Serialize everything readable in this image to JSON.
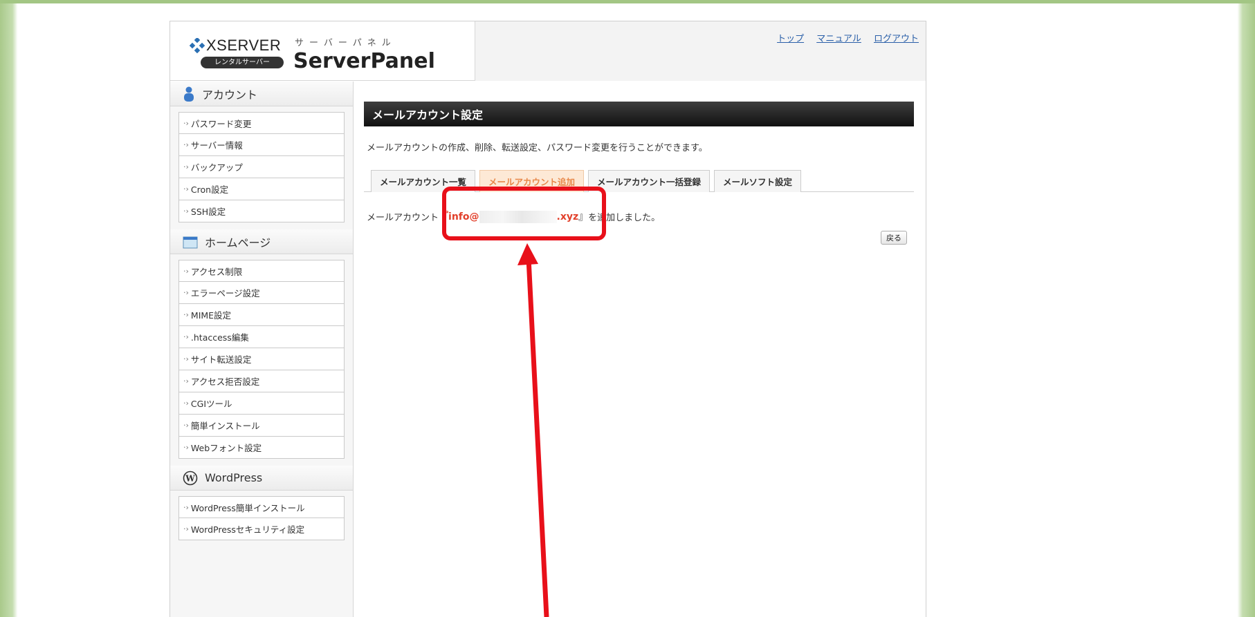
{
  "header": {
    "brand": "XSERVER",
    "badge": "レンタルサーバー",
    "kana": "サーバーパネル",
    "title": "ServerPanel",
    "links": [
      "トップ",
      "マニュアル",
      "ログアウト"
    ]
  },
  "sidebar": {
    "sections": [
      {
        "title": "アカウント",
        "icon": "user-icon",
        "items": [
          "パスワード変更",
          "サーバー情報",
          "バックアップ",
          "Cron設定",
          "SSH設定"
        ]
      },
      {
        "title": "ホームページ",
        "icon": "homepage-icon",
        "items": [
          "アクセス制限",
          "エラーページ設定",
          "MIME設定",
          ".htaccess編集",
          "サイト転送設定",
          "アクセス拒否設定",
          "CGIツール",
          "簡単インストール",
          "Webフォント設定"
        ]
      },
      {
        "title": "WordPress",
        "icon": "wordpress-icon",
        "items": [
          "WordPress簡単インストール",
          "WordPressセキュリティ設定"
        ]
      }
    ]
  },
  "main": {
    "title": "メールアカウント設定",
    "description": "メールアカウントの作成、削除、転送設定、パスワード変更を行うことができます。",
    "tabs": [
      {
        "label": "メールアカウント一覧",
        "active": false
      },
      {
        "label": "メールアカウント追加",
        "active": true
      },
      {
        "label": "メールアカウント一括登録",
        "active": false
      },
      {
        "label": "メールソフト設定",
        "active": false
      }
    ],
    "result_prefix": "メールアカウント",
    "result_open": "『",
    "result_local": "info@",
    "result_domain_suffix": ".xyz",
    "result_close": "』",
    "result_suffix": "を追加しました。",
    "back_label": "戻る"
  },
  "colors": {
    "accent_red": "#e8101a",
    "active_tab_text": "#e8884a",
    "background_green": "#a9c98a"
  }
}
